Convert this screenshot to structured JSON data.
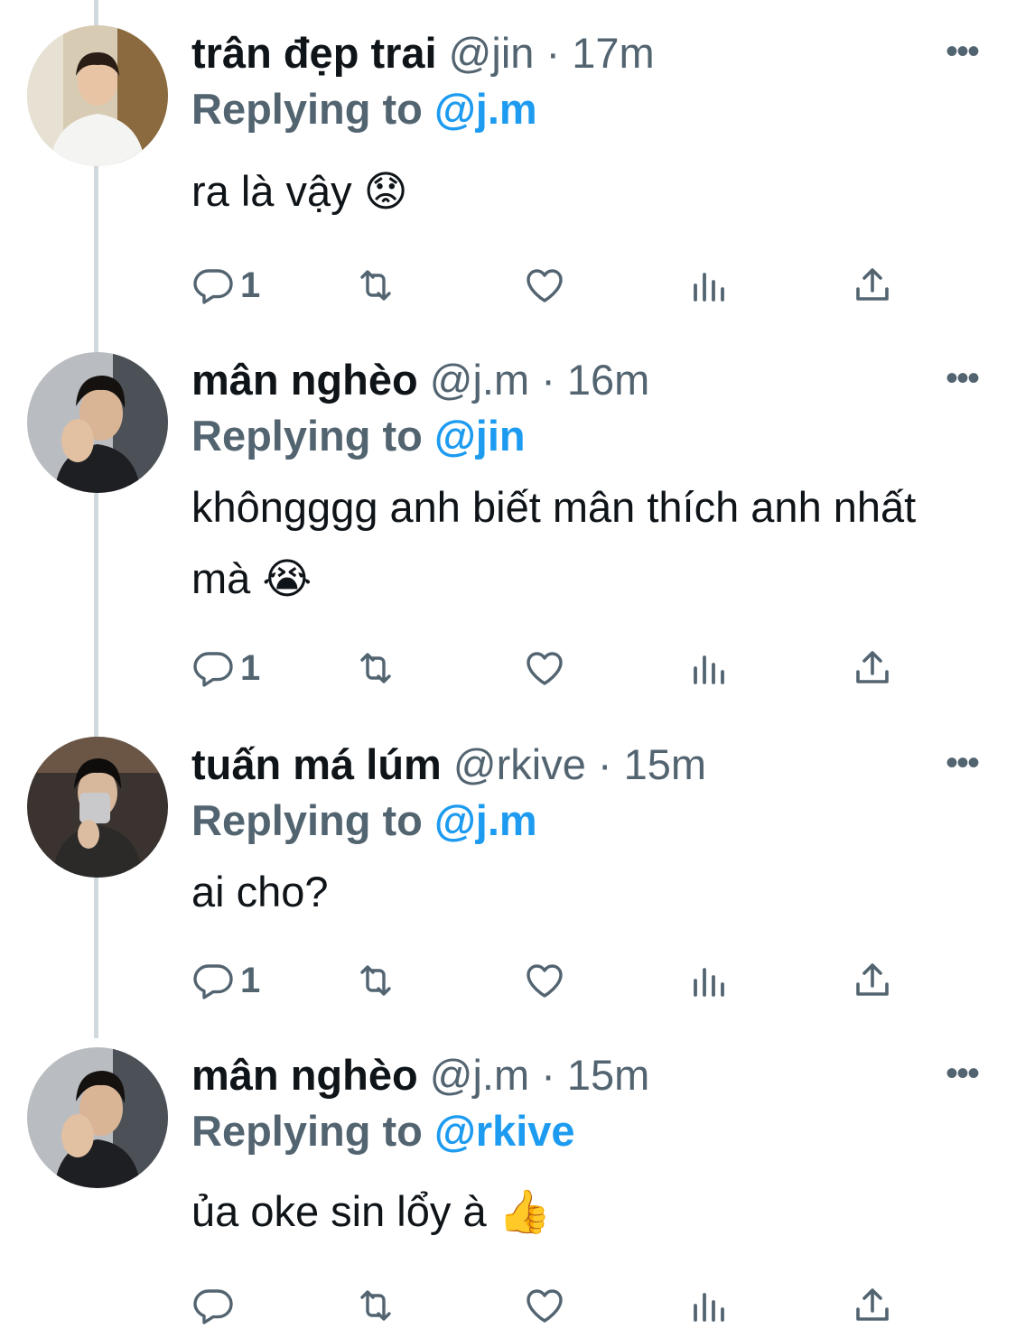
{
  "tweets": [
    {
      "name": "trân đẹp trai",
      "handle": "@jin",
      "sep": "·",
      "time": "17m",
      "replying_prefix": "Replying to",
      "replying_to": "@j.m",
      "text": "ra là vậy 😟",
      "reply_count": "1",
      "avatar": "avatar-jin"
    },
    {
      "name": "mân nghèo",
      "handle": "@j.m",
      "sep": "·",
      "time": "16m",
      "replying_prefix": "Replying to",
      "replying_to": "@jin",
      "text": "khôngggg anh biết mân thích anh nhất mà 😭",
      "reply_count": "1",
      "avatar": "avatar-jm"
    },
    {
      "name": "tuấn má lúm",
      "handle": "@rkive",
      "sep": "·",
      "time": "15m",
      "replying_prefix": "Replying to",
      "replying_to": "@j.m",
      "text": "ai cho?",
      "reply_count": "1",
      "avatar": "avatar-rkive"
    },
    {
      "name": "mân nghèo",
      "handle": "@j.m",
      "sep": "·",
      "time": "15m",
      "replying_prefix": "Replying to",
      "replying_to": "@rkive",
      "text": "ủa oke sin lổy à 👍",
      "reply_count": "",
      "avatar": "avatar-jm"
    }
  ],
  "more_label": "•••",
  "icons": {
    "reply": "reply-icon",
    "retweet": "retweet-icon",
    "like": "like-icon",
    "views": "views-icon",
    "share": "share-icon"
  },
  "colors": {
    "text": "#0f1419",
    "secondary": "#536471",
    "mention": "#1d9bf0",
    "thread_line": "#cfd9de"
  }
}
